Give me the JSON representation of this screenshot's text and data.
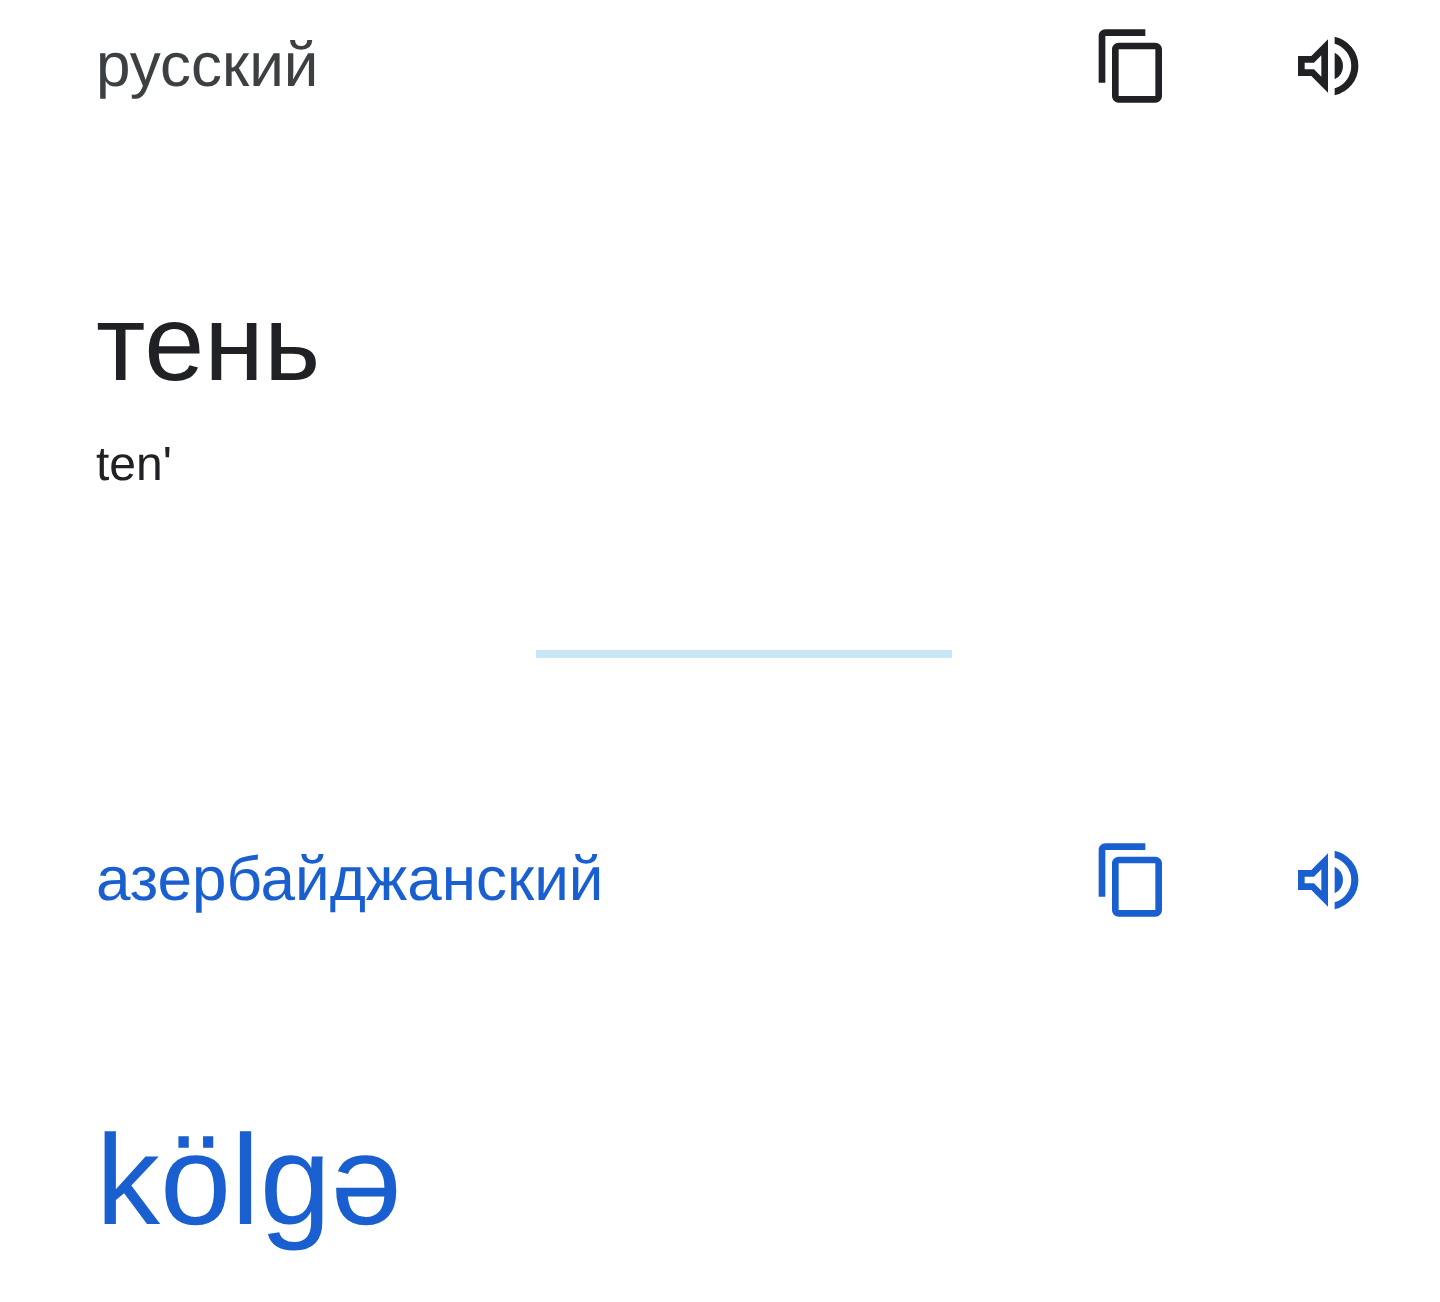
{
  "source": {
    "language": "русский",
    "text": "тень",
    "transliteration": "ten'"
  },
  "target": {
    "language": "азербайджанский",
    "text": "kölgə"
  }
}
